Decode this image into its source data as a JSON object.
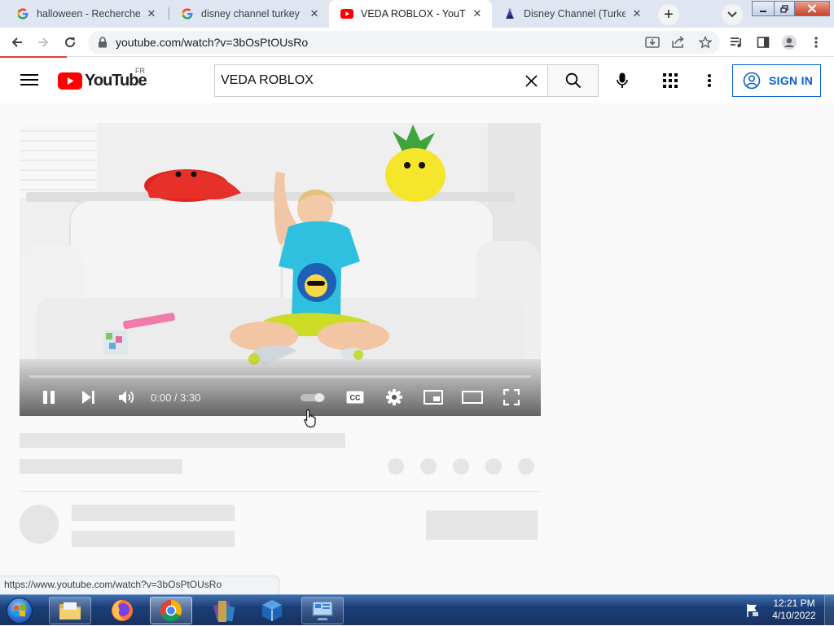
{
  "browser": {
    "tabs": [
      {
        "title": "halloween - Recherche G",
        "favicon": "google-icon",
        "active": false
      },
      {
        "title": "disney channel turkey - R",
        "favicon": "google-icon",
        "active": false
      },
      {
        "title": "VEDA ROBLOX - YouTube",
        "favicon": "youtube-icon",
        "active": true
      },
      {
        "title": "Disney Channel (Turkey) |",
        "favicon": "disney-icon",
        "active": false
      }
    ],
    "new_tab": "+",
    "close_glyph": "✕",
    "url": "youtube.com/watch?v=3bOsPtOUsRo",
    "status_url": "https://www.youtube.com/watch?v=3bOsPtOUsRo",
    "colors": {
      "loading": "#e53935"
    }
  },
  "youtube": {
    "logo_text": "YouTube",
    "country": "FR",
    "search_value": "VEDA ROBLOX",
    "sign_in": "SIGN IN",
    "colors": {
      "brand": "#ff0000",
      "accent": "#065fd4"
    }
  },
  "player": {
    "time": "0:00 / 3:30",
    "progress": 0,
    "controls": [
      "pause-icon",
      "next-icon",
      "volume-icon",
      "autoplay-toggle",
      "cc-icon",
      "settings-icon",
      "miniplayer-icon",
      "theater-icon",
      "fullscreen-icon"
    ],
    "cc_label": "CC"
  },
  "taskbar": {
    "time": "12:21 PM",
    "date": "4/10/2022",
    "items": [
      "explorer-icon",
      "firefox-icon",
      "chrome-icon",
      "winrar-icon",
      "virtualbox-icon",
      "control-panel-icon"
    ]
  }
}
